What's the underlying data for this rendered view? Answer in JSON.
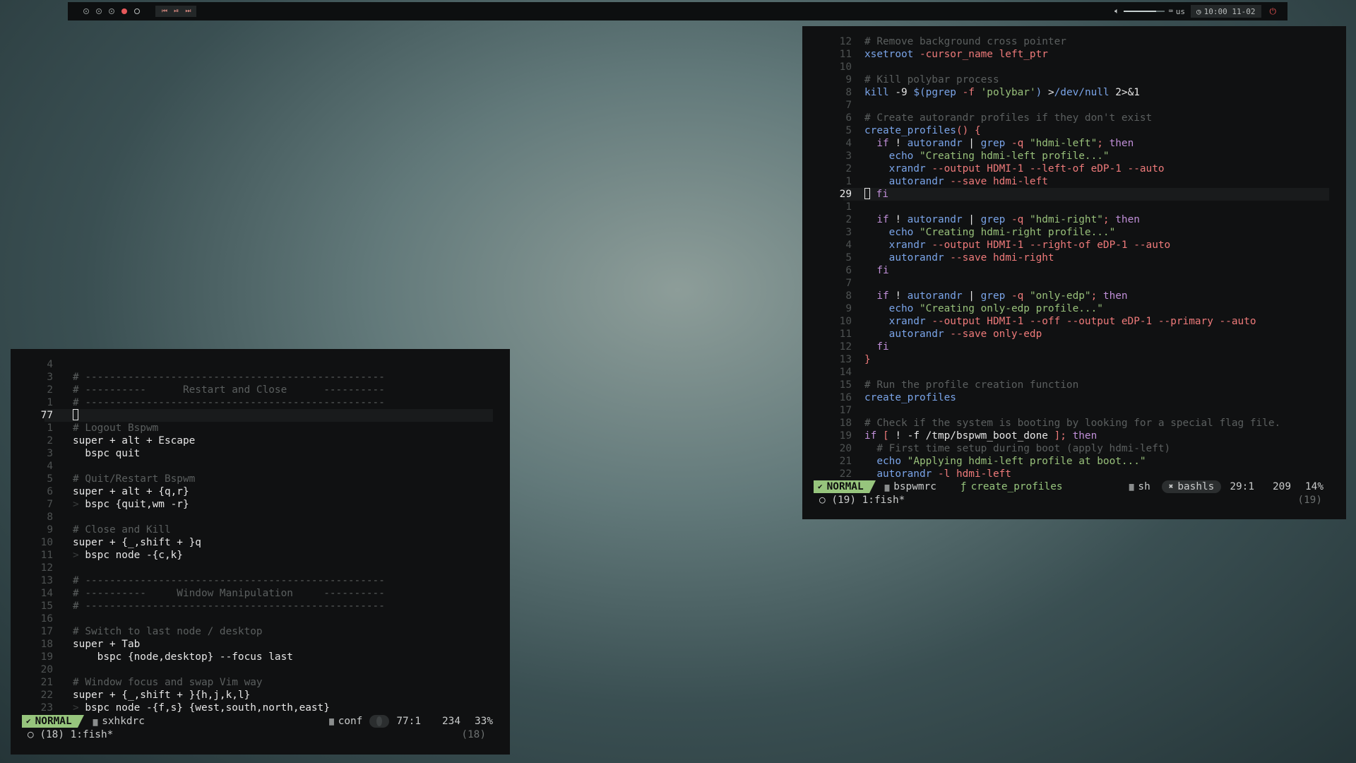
{
  "topbar": {
    "workspaces": [
      "occupied",
      "occupied",
      "occupied",
      "focused",
      "empty"
    ],
    "media_icons": [
      "previous-icon",
      "play-pause-icon",
      "next-icon"
    ],
    "media_glyphs": [
      "⏮",
      "⏯",
      "⏭"
    ],
    "volume_fraction": 0.8,
    "keyboard_layout": "us",
    "clock": "10:00 11-02",
    "colors": {
      "accent_red": "#e6585a",
      "bar_bg": "#0d0f10"
    }
  },
  "left_terminal": {
    "lines": [
      {
        "n": "4",
        "segs": []
      },
      {
        "n": "3",
        "segs": [
          [
            "c",
            "# -------------------------------------------------"
          ]
        ]
      },
      {
        "n": "2",
        "segs": [
          [
            "c",
            "# ----------      Restart and Close      ----------"
          ]
        ]
      },
      {
        "n": "1",
        "segs": [
          [
            "c",
            "# -------------------------------------------------"
          ]
        ]
      },
      {
        "n": "77",
        "cur": true,
        "segs": []
      },
      {
        "n": "1",
        "segs": [
          [
            "c",
            "# Logout Bspwm"
          ]
        ]
      },
      {
        "n": "2",
        "segs": [
          [
            "w",
            "super + alt + Escape"
          ]
        ]
      },
      {
        "n": "3",
        "segs": [
          [
            "w",
            "  bspc quit"
          ]
        ]
      },
      {
        "n": "4",
        "segs": []
      },
      {
        "n": "5",
        "segs": [
          [
            "c",
            "# Quit/Restart Bspwm"
          ]
        ]
      },
      {
        "n": "6",
        "segs": [
          [
            "w",
            "super + alt + {q,r}"
          ]
        ]
      },
      {
        "n": "7",
        "segs": [
          [
            "bar",
            "> "
          ],
          [
            "w",
            "bspc {quit,wm -r}"
          ]
        ]
      },
      {
        "n": "8",
        "segs": []
      },
      {
        "n": "9",
        "segs": [
          [
            "c",
            "# Close and Kill"
          ]
        ]
      },
      {
        "n": "10",
        "segs": [
          [
            "w",
            "super + {_,shift + }q"
          ]
        ]
      },
      {
        "n": "11",
        "segs": [
          [
            "bar",
            "> "
          ],
          [
            "w",
            "bspc node -{c,k}"
          ]
        ]
      },
      {
        "n": "12",
        "segs": []
      },
      {
        "n": "13",
        "segs": [
          [
            "c",
            "# -------------------------------------------------"
          ]
        ]
      },
      {
        "n": "14",
        "segs": [
          [
            "c",
            "# ----------     Window Manipulation     ----------"
          ]
        ]
      },
      {
        "n": "15",
        "segs": [
          [
            "c",
            "# -------------------------------------------------"
          ]
        ]
      },
      {
        "n": "16",
        "segs": []
      },
      {
        "n": "17",
        "segs": [
          [
            "c",
            "# Switch to last node / desktop"
          ]
        ]
      },
      {
        "n": "18",
        "segs": [
          [
            "w",
            "super + Tab"
          ]
        ]
      },
      {
        "n": "19",
        "segs": [
          [
            "w",
            "    bspc {node,desktop} --focus last"
          ]
        ]
      },
      {
        "n": "20",
        "segs": []
      },
      {
        "n": "21",
        "segs": [
          [
            "c",
            "# Window focus and swap Vim way"
          ]
        ]
      },
      {
        "n": "22",
        "segs": [
          [
            "w",
            "super + {_,shift + }{h,j,k,l}"
          ]
        ]
      },
      {
        "n": "23",
        "segs": [
          [
            "bar",
            "> "
          ],
          [
            "w",
            "bspc node -{f,s} {west,south,north,east}"
          ]
        ]
      }
    ],
    "status": {
      "mode": "NORMAL",
      "file": "sxhkdrc",
      "filetype": "conf",
      "position": "77:1",
      "count": "234",
      "percent": "33%"
    },
    "cmdline": {
      "left": "○ (18) 1:fish*",
      "right": "(18)"
    }
  },
  "right_terminal": {
    "lines": [
      {
        "n": "12",
        "segs": [
          [
            "c",
            "# Remove background cross pointer"
          ]
        ]
      },
      {
        "n": "11",
        "segs": [
          [
            "cmd",
            "xsetroot "
          ],
          [
            "opt",
            "-cursor_name left_ptr"
          ]
        ]
      },
      {
        "n": "10",
        "segs": []
      },
      {
        "n": "9",
        "segs": [
          [
            "c",
            "# Kill polybar process"
          ]
        ]
      },
      {
        "n": "8",
        "segs": [
          [
            "cmd",
            "kill "
          ],
          [
            "w",
            "-9 "
          ],
          [
            "cmd",
            "$(pgrep "
          ],
          [
            "opt",
            "-f "
          ],
          [
            "str",
            "'polybar'"
          ],
          [
            "cmd",
            ") "
          ],
          [
            "w",
            ">"
          ],
          [
            "cmd",
            "/dev/null "
          ],
          [
            "w",
            "2>&1"
          ]
        ]
      },
      {
        "n": "7",
        "segs": []
      },
      {
        "n": "6",
        "segs": [
          [
            "c",
            "# Create autorandr profiles if they don't exist"
          ]
        ]
      },
      {
        "n": "5",
        "segs": [
          [
            "fn",
            "create_profiles"
          ],
          [
            "opt",
            "() {"
          ]
        ]
      },
      {
        "n": "4",
        "segs": [
          [
            "w",
            "  "
          ],
          [
            "kw",
            "if "
          ],
          [
            "w",
            "! "
          ],
          [
            "cmd",
            "autorandr "
          ],
          [
            "w",
            "| "
          ],
          [
            "cmd",
            "grep "
          ],
          [
            "opt",
            "-q "
          ],
          [
            "str",
            "\"hdmi-left\""
          ],
          [
            "opt",
            "; "
          ],
          [
            "kw",
            "then"
          ]
        ]
      },
      {
        "n": "3",
        "segs": [
          [
            "w",
            "    "
          ],
          [
            "cmd",
            "echo "
          ],
          [
            "str",
            "\"Creating hdmi-left profile...\""
          ]
        ]
      },
      {
        "n": "2",
        "segs": [
          [
            "w",
            "    "
          ],
          [
            "cmd",
            "xrandr "
          ],
          [
            "opt",
            "--output HDMI-1 --left-of eDP-1 --auto"
          ]
        ]
      },
      {
        "n": "1",
        "segs": [
          [
            "w",
            "    "
          ],
          [
            "cmd",
            "autorandr "
          ],
          [
            "opt",
            "--save hdmi-left"
          ]
        ]
      },
      {
        "n": "29",
        "cur": true,
        "segs": [
          [
            "kw",
            "fi"
          ]
        ]
      },
      {
        "n": "1",
        "segs": []
      },
      {
        "n": "2",
        "segs": [
          [
            "w",
            "  "
          ],
          [
            "kw",
            "if "
          ],
          [
            "w",
            "! "
          ],
          [
            "cmd",
            "autorandr "
          ],
          [
            "w",
            "| "
          ],
          [
            "cmd",
            "grep "
          ],
          [
            "opt",
            "-q "
          ],
          [
            "str",
            "\"hdmi-right\""
          ],
          [
            "opt",
            "; "
          ],
          [
            "kw",
            "then"
          ]
        ]
      },
      {
        "n": "3",
        "segs": [
          [
            "w",
            "    "
          ],
          [
            "cmd",
            "echo "
          ],
          [
            "str",
            "\"Creating hdmi-right profile...\""
          ]
        ]
      },
      {
        "n": "4",
        "segs": [
          [
            "w",
            "    "
          ],
          [
            "cmd",
            "xrandr "
          ],
          [
            "opt",
            "--output HDMI-1 --right-of eDP-1 --auto"
          ]
        ]
      },
      {
        "n": "5",
        "segs": [
          [
            "w",
            "    "
          ],
          [
            "cmd",
            "autorandr "
          ],
          [
            "opt",
            "--save hdmi-right"
          ]
        ]
      },
      {
        "n": "6",
        "segs": [
          [
            "w",
            "  "
          ],
          [
            "kw",
            "fi"
          ]
        ]
      },
      {
        "n": "7",
        "segs": []
      },
      {
        "n": "8",
        "segs": [
          [
            "w",
            "  "
          ],
          [
            "kw",
            "if "
          ],
          [
            "w",
            "! "
          ],
          [
            "cmd",
            "autorandr "
          ],
          [
            "w",
            "| "
          ],
          [
            "cmd",
            "grep "
          ],
          [
            "opt",
            "-q "
          ],
          [
            "str",
            "\"only-edp\""
          ],
          [
            "opt",
            "; "
          ],
          [
            "kw",
            "then"
          ]
        ]
      },
      {
        "n": "9",
        "segs": [
          [
            "w",
            "    "
          ],
          [
            "cmd",
            "echo "
          ],
          [
            "str",
            "\"Creating only-edp profile...\""
          ]
        ]
      },
      {
        "n": "10",
        "segs": [
          [
            "w",
            "    "
          ],
          [
            "cmd",
            "xrandr "
          ],
          [
            "opt",
            "--output HDMI-1 --off --output eDP-1 --primary --auto"
          ]
        ]
      },
      {
        "n": "11",
        "segs": [
          [
            "w",
            "    "
          ],
          [
            "cmd",
            "autorandr "
          ],
          [
            "opt",
            "--save only-edp"
          ]
        ]
      },
      {
        "n": "12",
        "segs": [
          [
            "w",
            "  "
          ],
          [
            "kw",
            "fi"
          ]
        ]
      },
      {
        "n": "13",
        "segs": [
          [
            "opt",
            "}"
          ]
        ]
      },
      {
        "n": "14",
        "segs": []
      },
      {
        "n": "15",
        "segs": [
          [
            "c",
            "# Run the profile creation function"
          ]
        ]
      },
      {
        "n": "16",
        "segs": [
          [
            "cmd",
            "create_profiles"
          ]
        ]
      },
      {
        "n": "17",
        "segs": []
      },
      {
        "n": "18",
        "segs": [
          [
            "c",
            "# Check if the system is booting by looking for a special flag file."
          ]
        ]
      },
      {
        "n": "19",
        "segs": [
          [
            "kw",
            "if "
          ],
          [
            "opt",
            "[ "
          ],
          [
            "w",
            "! -f /tmp/bspwm_boot_done "
          ],
          [
            "opt",
            "]; "
          ],
          [
            "kw",
            "then"
          ]
        ]
      },
      {
        "n": "20",
        "segs": [
          [
            "w",
            "  "
          ],
          [
            "c",
            "# First time setup during boot (apply hdmi-left)"
          ]
        ]
      },
      {
        "n": "21",
        "segs": [
          [
            "w",
            "  "
          ],
          [
            "cmd",
            "echo "
          ],
          [
            "str",
            "\"Applying hdmi-left profile at boot...\""
          ]
        ]
      },
      {
        "n": "22",
        "segs": [
          [
            "w",
            "  "
          ],
          [
            "cmd",
            "autorandr "
          ],
          [
            "opt",
            "-l hdmi-left"
          ]
        ]
      }
    ],
    "status": {
      "mode": "NORMAL",
      "file": "bspwmrc",
      "function": "create_profiles",
      "filetype": "sh",
      "lsp": "bashls",
      "position": "29:1",
      "count": "209",
      "percent": "14%"
    },
    "cmdline": {
      "left": "○ (19) 1:fish*",
      "right": "(19)"
    }
  }
}
